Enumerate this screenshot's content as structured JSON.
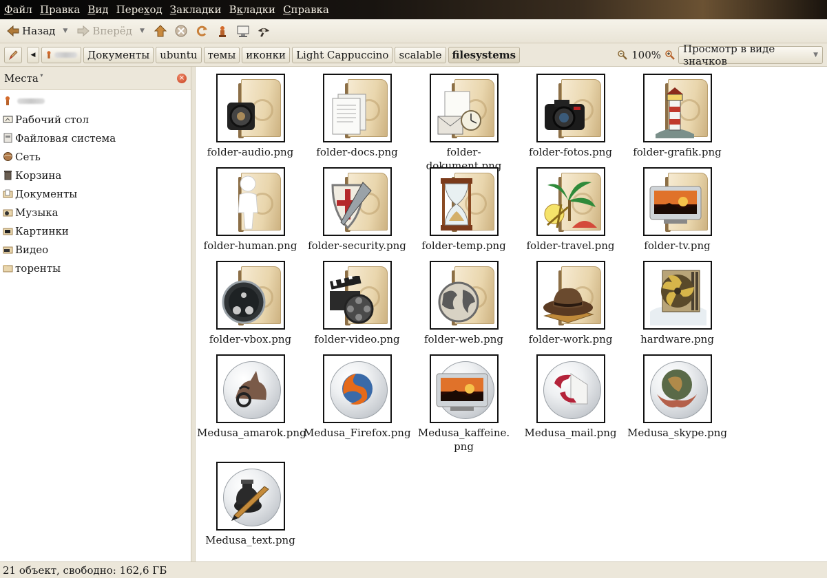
{
  "menu": [
    "Файл",
    "Правка",
    "Вид",
    "Переход",
    "Закладки",
    "Вкладки",
    "Справка"
  ],
  "menu_underline": [
    "Ф",
    "П",
    "В",
    "х",
    "З",
    "к",
    "С"
  ],
  "toolbar": {
    "back_label": "Назад",
    "forward_label": "Вперёд"
  },
  "breadcrumbs": [
    "Документы",
    "ubuntu",
    "темы",
    "иконки",
    "Light Cappuccino",
    "scalable",
    "filesystems"
  ],
  "zoom": {
    "level": "100%"
  },
  "view_mode": "Просмотр в виде значков",
  "sidebar": {
    "title": "Места",
    "items": [
      {
        "label": "",
        "icon": "home-icon"
      },
      {
        "label": "Рабочий стол",
        "icon": "desktop-icon"
      },
      {
        "label": "Файловая система",
        "icon": "filesystem-icon"
      },
      {
        "label": "Сеть",
        "icon": "network-icon"
      },
      {
        "label": "Корзина",
        "icon": "trash-icon"
      },
      {
        "label": "Документы",
        "icon": "folder-documents-icon"
      },
      {
        "label": "Музыка",
        "icon": "folder-music-icon"
      },
      {
        "label": "Картинки",
        "icon": "folder-pictures-icon"
      },
      {
        "label": "Видео",
        "icon": "folder-video-icon"
      },
      {
        "label": "торенты",
        "icon": "folder-icon"
      }
    ]
  },
  "files": [
    {
      "name": "folder-audio.png",
      "kind": "folder",
      "emblem": "speaker"
    },
    {
      "name": "folder-docs.png",
      "kind": "folder",
      "emblem": "docs"
    },
    {
      "name": "folder-dokument.png",
      "kind": "folder",
      "emblem": "dokument"
    },
    {
      "name": "folder-fotos.png",
      "kind": "folder",
      "emblem": "camera"
    },
    {
      "name": "folder-grafik.png",
      "kind": "folder",
      "emblem": "lighthouse"
    },
    {
      "name": "folder-human.png",
      "kind": "folder",
      "emblem": "human"
    },
    {
      "name": "folder-security.png",
      "kind": "folder",
      "emblem": "shield"
    },
    {
      "name": "folder-temp.png",
      "kind": "folder",
      "emblem": "hourglass"
    },
    {
      "name": "folder-travel.png",
      "kind": "folder",
      "emblem": "palm"
    },
    {
      "name": "folder-tv.png",
      "kind": "folder",
      "emblem": "tv"
    },
    {
      "name": "folder-vbox.png",
      "kind": "folder",
      "emblem": "vbox"
    },
    {
      "name": "folder-video.png",
      "kind": "folder",
      "emblem": "film"
    },
    {
      "name": "folder-web.png",
      "kind": "folder",
      "emblem": "globe"
    },
    {
      "name": "folder-work.png",
      "kind": "folder",
      "emblem": "hat"
    },
    {
      "name": "hardware.png",
      "kind": "hardware",
      "emblem": "fan"
    },
    {
      "name": "Medusa_amarok.png",
      "kind": "orb",
      "emblem": "wolf"
    },
    {
      "name": "Medusa_Firefox.png",
      "kind": "orb",
      "emblem": "firefox"
    },
    {
      "name": "Medusa_kaffeine.png",
      "kind": "orb",
      "emblem": "tv"
    },
    {
      "name": "Medusa_mail.png",
      "kind": "orb",
      "emblem": "mail"
    },
    {
      "name": "Medusa_skype.png",
      "kind": "orb",
      "emblem": "hands"
    },
    {
      "name": "Medusa_text.png",
      "kind": "orb",
      "emblem": "ink"
    }
  ],
  "status": "21 объект, свободно: 162,6 ГБ",
  "colors": {
    "menubar_dark": "#050505",
    "menubar_accent": "#6b5233",
    "chrome": "#ece7da",
    "folder": "#e9d6ad"
  }
}
